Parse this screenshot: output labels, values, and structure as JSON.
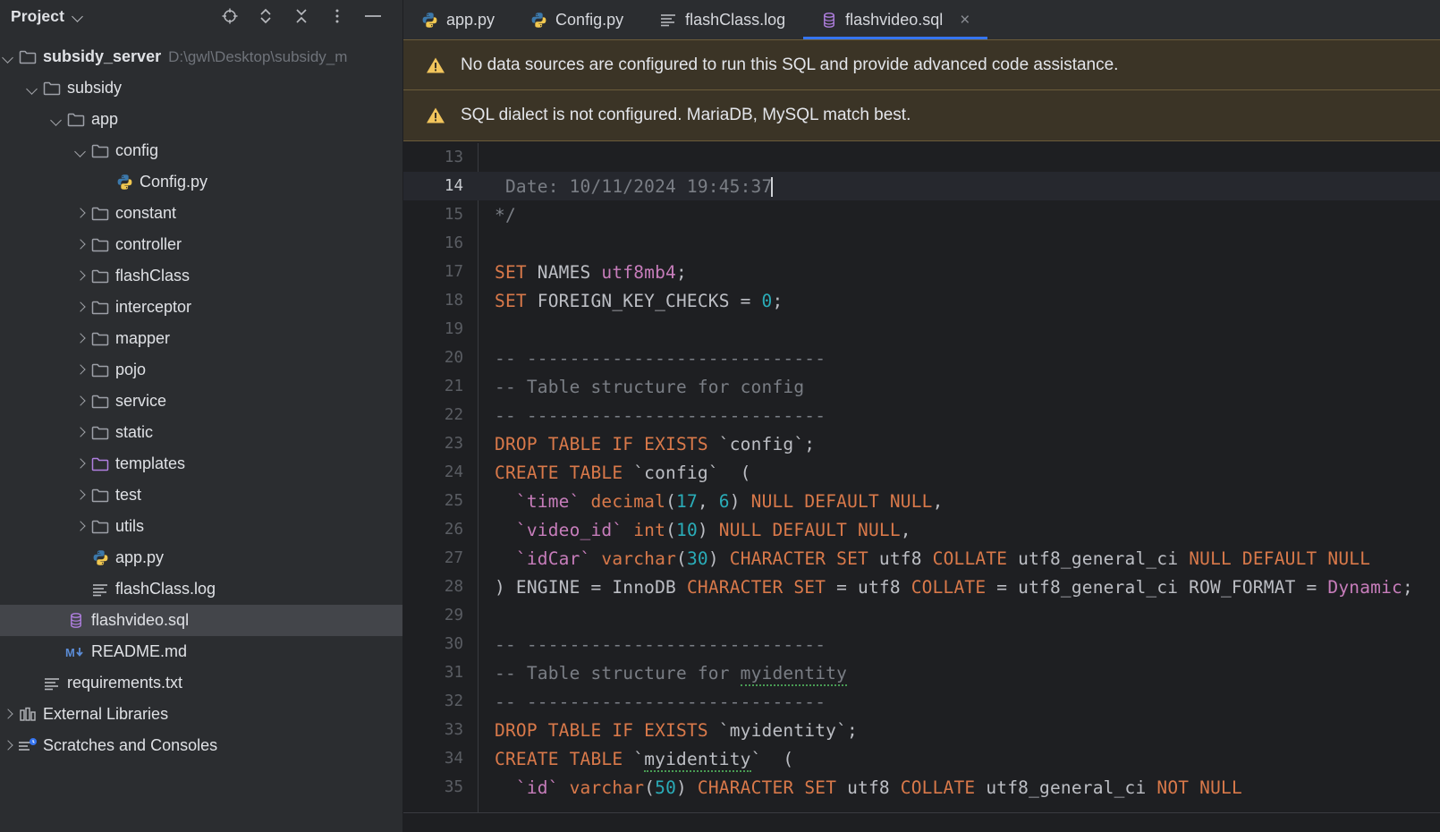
{
  "sidebar": {
    "title": "Project",
    "title_chevron_icon": "chevron-down-icon",
    "tools": [
      {
        "name": "locate-file-icon",
        "label": "Select Opened File"
      },
      {
        "name": "expand-all-icon",
        "label": "Expand All"
      },
      {
        "name": "collapse-all-icon",
        "label": "Collapse All"
      },
      {
        "name": "more-options-icon",
        "label": "Options"
      },
      {
        "name": "minimize-icon",
        "label": "Hide"
      }
    ],
    "tree": [
      {
        "label": "subsidy_server",
        "path": "D:\\gwl\\Desktop\\subsidy_m",
        "icon": "folder-icon",
        "arrow": "down",
        "indent": 0,
        "bold": true,
        "selected": false
      },
      {
        "label": "subsidy",
        "path": "",
        "icon": "folder-icon",
        "arrow": "down",
        "indent": 1,
        "bold": false,
        "selected": false
      },
      {
        "label": "app",
        "path": "",
        "icon": "folder-icon",
        "arrow": "down",
        "indent": 2,
        "bold": false,
        "selected": false
      },
      {
        "label": "config",
        "path": "",
        "icon": "folder-icon",
        "arrow": "down",
        "indent": 3,
        "bold": false,
        "selected": false
      },
      {
        "label": "Config.py",
        "path": "",
        "icon": "python-file-icon",
        "arrow": "none",
        "indent": 4,
        "bold": false,
        "selected": false
      },
      {
        "label": "constant",
        "path": "",
        "icon": "folder-icon",
        "arrow": "right",
        "indent": 3,
        "bold": false,
        "selected": false
      },
      {
        "label": "controller",
        "path": "",
        "icon": "folder-icon",
        "arrow": "right",
        "indent": 3,
        "bold": false,
        "selected": false
      },
      {
        "label": "flashClass",
        "path": "",
        "icon": "folder-icon",
        "arrow": "right",
        "indent": 3,
        "bold": false,
        "selected": false
      },
      {
        "label": "interceptor",
        "path": "",
        "icon": "folder-icon",
        "arrow": "right",
        "indent": 3,
        "bold": false,
        "selected": false
      },
      {
        "label": "mapper",
        "path": "",
        "icon": "folder-icon",
        "arrow": "right",
        "indent": 3,
        "bold": false,
        "selected": false
      },
      {
        "label": "pojo",
        "path": "",
        "icon": "folder-icon",
        "arrow": "right",
        "indent": 3,
        "bold": false,
        "selected": false
      },
      {
        "label": "service",
        "path": "",
        "icon": "folder-icon",
        "arrow": "right",
        "indent": 3,
        "bold": false,
        "selected": false
      },
      {
        "label": "static",
        "path": "",
        "icon": "folder-icon",
        "arrow": "right",
        "indent": 3,
        "bold": false,
        "selected": false
      },
      {
        "label": "templates",
        "path": "",
        "icon": "folder-templates-icon",
        "arrow": "right",
        "indent": 3,
        "bold": false,
        "selected": false
      },
      {
        "label": "test",
        "path": "",
        "icon": "folder-icon",
        "arrow": "right",
        "indent": 3,
        "bold": false,
        "selected": false
      },
      {
        "label": "utils",
        "path": "",
        "icon": "folder-icon",
        "arrow": "right",
        "indent": 3,
        "bold": false,
        "selected": false
      },
      {
        "label": "app.py",
        "path": "",
        "icon": "python-file-icon",
        "arrow": "none",
        "indent": 3,
        "bold": false,
        "selected": false
      },
      {
        "label": "flashClass.log",
        "path": "",
        "icon": "text-file-icon",
        "arrow": "none",
        "indent": 3,
        "bold": false,
        "selected": false
      },
      {
        "label": "flashvideo.sql",
        "path": "",
        "icon": "sql-file-icon",
        "arrow": "none",
        "indent": 2,
        "bold": false,
        "selected": true
      },
      {
        "label": "README.md",
        "path": "",
        "icon": "markdown-file-icon",
        "arrow": "none",
        "indent": 2,
        "bold": false,
        "selected": false
      },
      {
        "label": "requirements.txt",
        "path": "",
        "icon": "text-file-icon",
        "arrow": "none",
        "indent": 1,
        "bold": false,
        "selected": false
      },
      {
        "label": "External Libraries",
        "path": "",
        "icon": "library-icon",
        "arrow": "right",
        "indent": 0,
        "bold": false,
        "selected": false
      },
      {
        "label": "Scratches and Consoles",
        "path": "",
        "icon": "scratches-icon",
        "arrow": "right",
        "indent": 0,
        "bold": false,
        "selected": false
      }
    ]
  },
  "editor": {
    "tabs": [
      {
        "label": "app.py",
        "icon": "python-file-icon",
        "active": false,
        "closable": false
      },
      {
        "label": "Config.py",
        "icon": "python-file-icon",
        "active": false,
        "closable": false
      },
      {
        "label": "flashClass.log",
        "icon": "text-file-icon",
        "active": false,
        "closable": false
      },
      {
        "label": "flashvideo.sql",
        "icon": "sql-file-icon",
        "active": true,
        "closable": true,
        "close_label": "×"
      }
    ],
    "banners": [
      {
        "icon": "warning-icon",
        "text": "No data sources are configured to run this SQL and provide advanced code assistance."
      },
      {
        "icon": "warning-icon",
        "text": "SQL dialect is not configured. MariaDB, MySQL match best."
      }
    ],
    "current_line": 14,
    "lines": [
      {
        "n": 13,
        "tokens": []
      },
      {
        "n": 14,
        "tokens": [
          {
            "t": " Date: 10/11/2024 19:45:37",
            "c": "cmt"
          }
        ],
        "caret": true
      },
      {
        "n": 15,
        "tokens": [
          {
            "t": "*/",
            "c": "cmt"
          }
        ]
      },
      {
        "n": 16,
        "tokens": []
      },
      {
        "n": 17,
        "tokens": [
          {
            "t": "SET",
            "c": "kw"
          },
          {
            "t": " NAMES ",
            "c": "plain"
          },
          {
            "t": "utf8mb4",
            "c": "str"
          },
          {
            "t": ";",
            "c": "plain"
          }
        ]
      },
      {
        "n": 18,
        "tokens": [
          {
            "t": "SET",
            "c": "kw"
          },
          {
            "t": " FOREIGN_KEY_CHECKS = ",
            "c": "plain"
          },
          {
            "t": "0",
            "c": "num"
          },
          {
            "t": ";",
            "c": "plain"
          }
        ]
      },
      {
        "n": 19,
        "tokens": []
      },
      {
        "n": 20,
        "tokens": [
          {
            "t": "-- ----------------------------",
            "c": "cmt"
          }
        ]
      },
      {
        "n": 21,
        "tokens": [
          {
            "t": "-- Table structure for config",
            "c": "cmt"
          }
        ]
      },
      {
        "n": 22,
        "tokens": [
          {
            "t": "-- ----------------------------",
            "c": "cmt"
          }
        ]
      },
      {
        "n": 23,
        "tokens": [
          {
            "t": "DROP TABLE IF EXISTS ",
            "c": "kw"
          },
          {
            "t": "`config`;",
            "c": "plain"
          }
        ]
      },
      {
        "n": 24,
        "tokens": [
          {
            "t": "CREATE TABLE ",
            "c": "kw"
          },
          {
            "t": "`config`  (",
            "c": "plain"
          }
        ]
      },
      {
        "n": 25,
        "tokens": [
          {
            "t": "  ",
            "c": "plain"
          },
          {
            "t": "`time`",
            "c": "ident"
          },
          {
            "t": " decimal",
            "c": "kw"
          },
          {
            "t": "(",
            "c": "plain"
          },
          {
            "t": "17",
            "c": "num"
          },
          {
            "t": ", ",
            "c": "plain"
          },
          {
            "t": "6",
            "c": "num"
          },
          {
            "t": ") ",
            "c": "plain"
          },
          {
            "t": "NULL DEFAULT NULL",
            "c": "kw"
          },
          {
            "t": ",",
            "c": "plain"
          }
        ]
      },
      {
        "n": 26,
        "tokens": [
          {
            "t": "  ",
            "c": "plain"
          },
          {
            "t": "`video_id`",
            "c": "ident"
          },
          {
            "t": " int",
            "c": "kw"
          },
          {
            "t": "(",
            "c": "plain"
          },
          {
            "t": "10",
            "c": "num"
          },
          {
            "t": ") ",
            "c": "plain"
          },
          {
            "t": "NULL DEFAULT NULL",
            "c": "kw"
          },
          {
            "t": ",",
            "c": "plain"
          }
        ]
      },
      {
        "n": 27,
        "tokens": [
          {
            "t": "  ",
            "c": "plain"
          },
          {
            "t": "`idCar`",
            "c": "ident"
          },
          {
            "t": " varchar",
            "c": "kw"
          },
          {
            "t": "(",
            "c": "plain"
          },
          {
            "t": "30",
            "c": "num"
          },
          {
            "t": ") ",
            "c": "plain"
          },
          {
            "t": "CHARACTER SET ",
            "c": "kw"
          },
          {
            "t": "utf8 ",
            "c": "plain"
          },
          {
            "t": "COLLATE ",
            "c": "kw"
          },
          {
            "t": "utf8_general_ci ",
            "c": "plain"
          },
          {
            "t": "NULL DEFAULT NULL",
            "c": "kw"
          }
        ]
      },
      {
        "n": 28,
        "tokens": [
          {
            "t": ") ",
            "c": "plain"
          },
          {
            "t": "ENGINE",
            "c": "plain"
          },
          {
            "t": " = ",
            "c": "plain"
          },
          {
            "t": "InnoDB ",
            "c": "plain"
          },
          {
            "t": "CHARACTER SET",
            "c": "kw"
          },
          {
            "t": " = utf8 ",
            "c": "plain"
          },
          {
            "t": "COLLATE",
            "c": "kw"
          },
          {
            "t": " = utf8_general_ci ROW_FORMAT = ",
            "c": "plain"
          },
          {
            "t": "Dynamic",
            "c": "str"
          },
          {
            "t": ";",
            "c": "plain"
          }
        ]
      },
      {
        "n": 29,
        "tokens": []
      },
      {
        "n": 30,
        "tokens": [
          {
            "t": "-- ----------------------------",
            "c": "cmt"
          }
        ]
      },
      {
        "n": 31,
        "tokens": [
          {
            "t": "-- Table structure for ",
            "c": "cmt"
          },
          {
            "t": "myidentity",
            "c": "cmt",
            "squiggle": true
          }
        ]
      },
      {
        "n": 32,
        "tokens": [
          {
            "t": "-- ----------------------------",
            "c": "cmt"
          }
        ]
      },
      {
        "n": 33,
        "tokens": [
          {
            "t": "DROP TABLE IF EXISTS ",
            "c": "kw"
          },
          {
            "t": "`myidentity`;",
            "c": "plain"
          }
        ]
      },
      {
        "n": 34,
        "tokens": [
          {
            "t": "CREATE TABLE ",
            "c": "kw"
          },
          {
            "t": "`",
            "c": "plain"
          },
          {
            "t": "myidentity",
            "c": "plain",
            "squiggle": true
          },
          {
            "t": "`  (",
            "c": "plain"
          }
        ]
      },
      {
        "n": 35,
        "tokens": [
          {
            "t": "  ",
            "c": "plain"
          },
          {
            "t": "`id`",
            "c": "ident"
          },
          {
            "t": " varchar",
            "c": "kw"
          },
          {
            "t": "(",
            "c": "plain"
          },
          {
            "t": "50",
            "c": "num"
          },
          {
            "t": ") ",
            "c": "plain"
          },
          {
            "t": "CHARACTER SET ",
            "c": "kw"
          },
          {
            "t": "utf8 ",
            "c": "plain"
          },
          {
            "t": "COLLATE ",
            "c": "kw"
          },
          {
            "t": "utf8_general_ci ",
            "c": "plain"
          },
          {
            "t": "NOT NULL",
            "c": "kw"
          }
        ]
      }
    ]
  },
  "colors": {
    "accent": "#3574f0",
    "warning": "#f2c55c",
    "banner_bg": "#3b3426",
    "selection": "#43454a",
    "editor_bg": "#1e1f22",
    "sidebar_bg": "#2b2d30"
  }
}
